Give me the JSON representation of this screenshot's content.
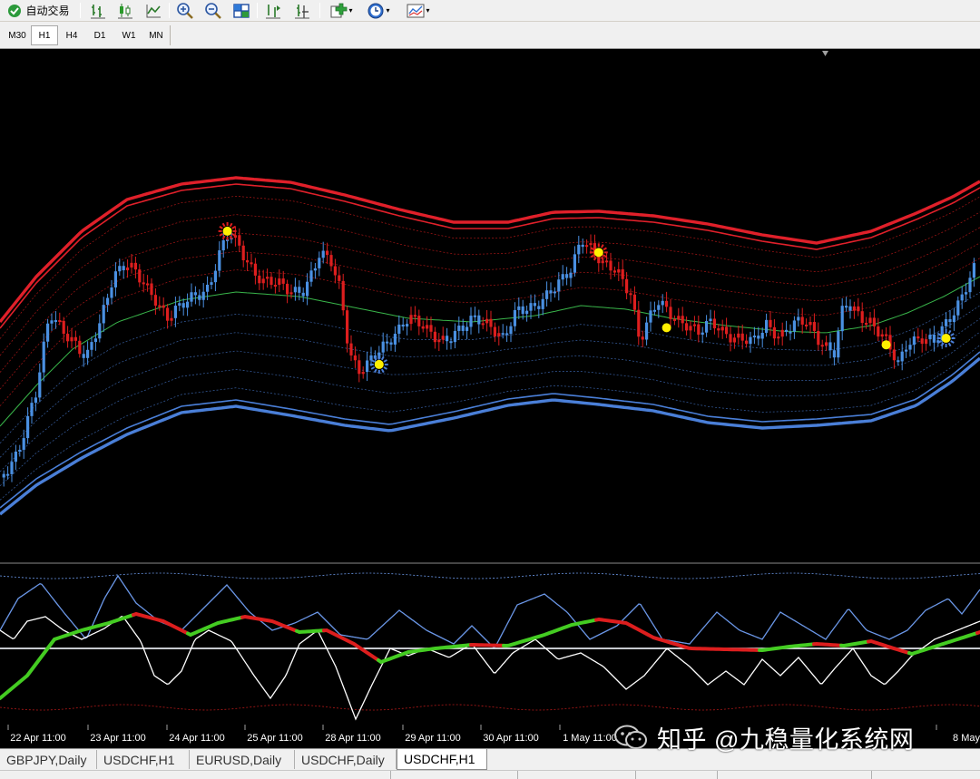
{
  "toolbar": {
    "autotrade_label": "自动交易",
    "buttons": [
      "bar-chart-icon",
      "candlestick-icon",
      "line-chart-icon",
      "zoom-in-icon",
      "zoom-out-icon",
      "tile-windows-icon",
      "auto-scroll-icon",
      "chart-shift-icon",
      "add-indicator-icon",
      "periods-icon",
      "templates-icon"
    ]
  },
  "timeframes": {
    "items": [
      "M30",
      "H1",
      "H4",
      "D1",
      "W1",
      "MN"
    ],
    "active": "H1"
  },
  "chart_data": {
    "type": "line",
    "x_tick_labels": [
      "22 Apr 11:00",
      "23 Apr 11:00",
      "24 Apr 11:00",
      "25 Apr 11:00",
      "28 Apr 11:00",
      "29 Apr 11:00",
      "30 Apr 11:00",
      "1 May 11:00",
      "8 May"
    ],
    "colors": {
      "background": "#000000",
      "up_bar": "#4a90e2",
      "down_bar": "#dd1e1e",
      "upper_band": "#e0202a",
      "lower_band": "#4a7fd8",
      "middle_line": "#39b54a",
      "signal_dot": "#ffef00",
      "osc_bull": "#44cc22",
      "osc_bear": "#dd1e1e",
      "osc_line": "#ffffff",
      "osc_blue": "#6a96e6",
      "zero_line": "#ffffff"
    },
    "signals": [
      {
        "type": "top-star",
        "bar": 56
      },
      {
        "type": "bottom-star",
        "bar": 94
      },
      {
        "type": "top-star",
        "bar": 149
      },
      {
        "type": "dot",
        "bar": 166
      },
      {
        "type": "dot",
        "bar": 221
      },
      {
        "type": "bottom-star",
        "bar": 236
      }
    ]
  },
  "tabs": {
    "items": [
      "GBPJPY,Daily",
      "USDCHF,H1",
      "EURUSD,Daily",
      "USDCHF,Daily",
      "USDCHF,H1"
    ],
    "active_index": 4
  },
  "watermark": {
    "text": "知乎 @九稳量化系统网"
  }
}
